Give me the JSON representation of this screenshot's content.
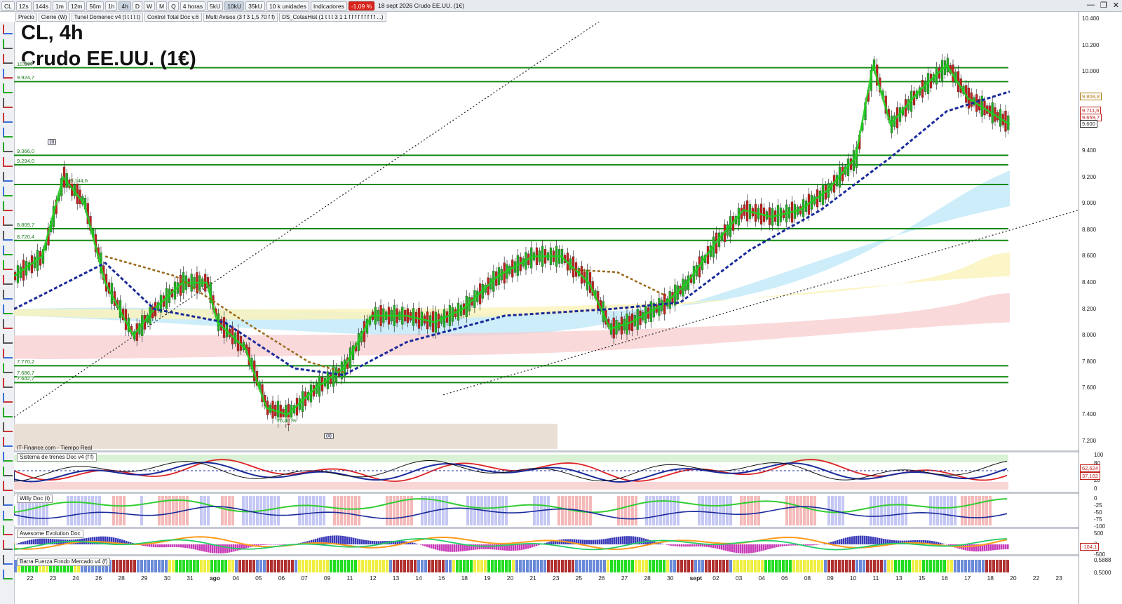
{
  "toolbar": {
    "symbol": "CL",
    "timeframes": [
      "12s",
      "144s",
      "1m",
      "12m",
      "56m",
      "1h",
      "4h",
      "D",
      "W",
      "M",
      "Q"
    ],
    "period_select": "4 horas",
    "units": [
      "5kU",
      "10kU",
      "35kU"
    ],
    "units_select": "10 k unidades",
    "indicators_label": "Indicadores",
    "change_badge": "-1,09 %",
    "title": "18 sept 2026 Crudo EE.UU. (1€)"
  },
  "indicators_bar": [
    "Precio",
    "Cierre (W)",
    "Tunel Domenec v4 (t t t t t)",
    "Control Total Doc v.6",
    "Multi Avisos (3 f 3 1,5 70 f f)",
    "DS_CotasHist (1 t t t 3 1 1 f f f f f f f f f ...)"
  ],
  "chart_title": {
    "line1": "CL, 4h",
    "line2": "Crudo EE.UU. (1€)"
  },
  "source_label": "IT-Finance.com - Tiempo Real",
  "levels": [
    {
      "label": "10.0??",
      "price": 10.03
    },
    {
      "label": "9.924,7",
      "price": 9.9247
    },
    {
      "label": "9.366,0",
      "price": 9.366
    },
    {
      "label": "9.294,0",
      "price": 9.294
    },
    {
      "label": "9.144,6",
      "price": 9.1446
    },
    {
      "label": "8.809,7",
      "price": 8.8097
    },
    {
      "label": "8.720,4",
      "price": 8.7204
    },
    {
      "label": "7.770,2",
      "price": 7.7702
    },
    {
      "label": "7.686,7",
      "price": 7.6867
    },
    {
      "label": "7.642,7",
      "price": 7.6427
    }
  ],
  "fib_label": "76,40 %",
  "wave_labels": [
    "(i)",
    "(ii)"
  ],
  "price_axis": [
    "10.400",
    "10.200",
    "10.000",
    "9.800",
    "9.600",
    "9.400",
    "9.200",
    "9.000",
    "8.800",
    "8.600",
    "8.400",
    "8.200",
    "8.000",
    "7.800",
    "7.600",
    "7.400",
    "7.200"
  ],
  "price_tags": [
    {
      "label": "9.808,8",
      "color": "#b07a10"
    },
    {
      "label": "9.711,6",
      "color": "#c0201b"
    },
    {
      "label": "9.659,7",
      "color": "#c0201b"
    },
    {
      "label": "9.600",
      "color": "#333333"
    }
  ],
  "panels": [
    {
      "title": "Sistema de trenes Doc v4 (f f)",
      "axis": [
        "100",
        "80",
        "50",
        "20",
        "0"
      ],
      "tags": [
        "62,624",
        "37,162"
      ]
    },
    {
      "title": "Willy Doc (t)",
      "axis": [
        "0",
        "-25",
        "-50",
        "-75",
        "-100"
      ],
      "tags": []
    },
    {
      "title": "Awesome Evolution Doc",
      "axis": [
        "500",
        "0",
        "-500"
      ],
      "tags": [
        "-104,1"
      ]
    },
    {
      "title": "Barra Fuerza Fondo Mercado v4 (f)",
      "axis": [
        "0,5888",
        "0,5000"
      ],
      "tags": []
    }
  ],
  "dates": [
    "22",
    "23",
    "24",
    "26",
    "28",
    "29",
    "30",
    "31",
    "ago",
    "04",
    "05",
    "06",
    "07",
    "09",
    "11",
    "12",
    "13",
    "14",
    "16",
    "18",
    "19",
    "20",
    "21",
    "23",
    "25",
    "26",
    "27",
    "28",
    "30",
    "sept",
    "02",
    "03",
    "04",
    "06",
    "08",
    "09",
    "10",
    "11",
    "13",
    "15",
    "16",
    "17",
    "18",
    "20",
    "22",
    "23"
  ],
  "colors": {
    "level": "#118a11",
    "ema_fast": "#1fd01f",
    "ema_slow_dash": "#1a2a9a",
    "down": "#c0201b",
    "brown_dash": "#9a6a1a"
  }
}
